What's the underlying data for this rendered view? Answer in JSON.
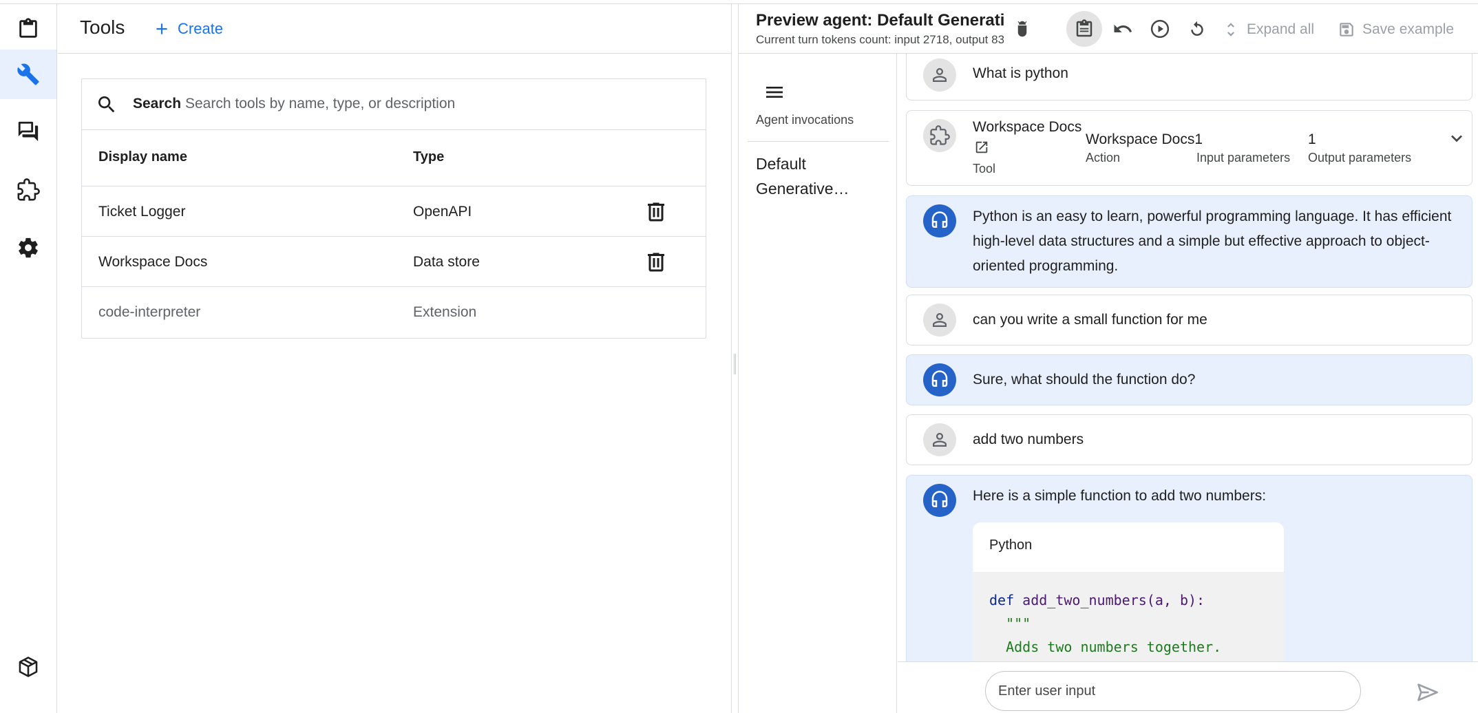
{
  "rail": {
    "items": [
      {
        "name": "clipboard-icon",
        "active": false
      },
      {
        "name": "wrench-icon",
        "active": true
      },
      {
        "name": "chat-icon",
        "active": false
      },
      {
        "name": "puzzle-icon",
        "active": false
      },
      {
        "name": "gear-icon",
        "active": false
      },
      {
        "name": "package-icon",
        "active": false
      }
    ]
  },
  "tools": {
    "title": "Tools",
    "create_label": "Create",
    "search": {
      "label": "Search",
      "placeholder": "Search tools by name, type, or description",
      "value": ""
    },
    "columns": {
      "display_name": "Display name",
      "type": "Type"
    },
    "rows": [
      {
        "name": "Ticket Logger",
        "type": "OpenAPI",
        "deletable": true
      },
      {
        "name": "Workspace Docs",
        "type": "Data store",
        "deletable": true
      },
      {
        "name": "code-interpreter",
        "type": "Extension",
        "deletable": false
      }
    ]
  },
  "preview": {
    "title": "Preview agent: Default Generative Agent",
    "subtitle": "Current turn tokens count: input 2718, output 83",
    "expand_all_label": "Expand all",
    "save_example_label": "Save example",
    "invocations_label": "Agent invocations",
    "invocation_item": "Default Generative…",
    "messages": {
      "m1": "What is python",
      "tool": {
        "name": "Workspace Docs",
        "kind": "Tool",
        "action_value": "Workspace Docs1",
        "action_label": "Action",
        "input_label": "Input parameters",
        "output_value": "1",
        "output_label": "Output parameters"
      },
      "m2": "Python is an easy to learn, powerful programming language. It has efficient high-level data structures and a simple but effective approach to object-oriented programming.",
      "m3": "can you write a small function for me",
      "m4": "Sure, what should the function do?",
      "m5": "add two numbers",
      "m6": "Here is a simple function to add two numbers:",
      "code": {
        "language": "Python",
        "kw_def": "def",
        "fn_sig": "add_two_numbers(a, b):",
        "doc_open": "\"\"\"",
        "doc_line": "Adds two numbers together."
      }
    },
    "input_placeholder": "Enter user input"
  },
  "colors": {
    "accent": "#1a73e8",
    "agent_bubble": "#e8effd",
    "bot_avatar": "#2563c9",
    "rail_active": "#e8f0fe"
  }
}
